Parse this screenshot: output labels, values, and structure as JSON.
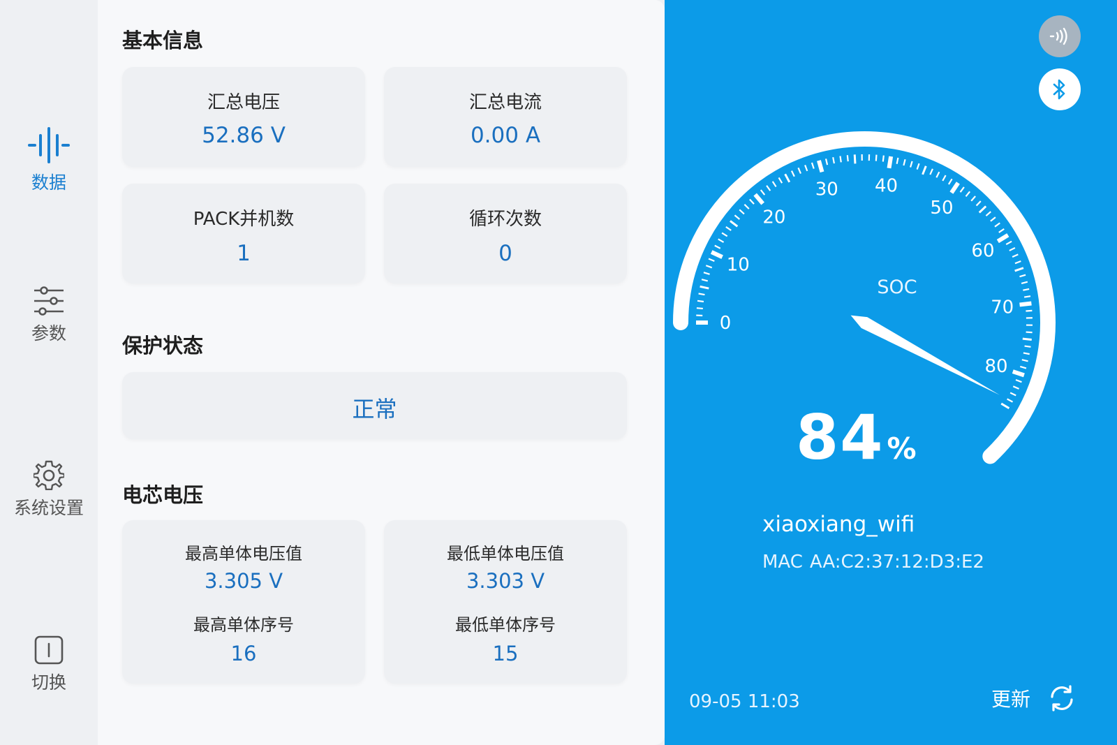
{
  "sidebar": {
    "items": [
      {
        "label": "数据",
        "icon": "data-bars-icon",
        "active": true
      },
      {
        "label": "参数",
        "icon": "sliders-icon",
        "active": false
      },
      {
        "label": "系统设置",
        "icon": "gear-icon",
        "active": false
      },
      {
        "label": "切换",
        "icon": "switch-icon",
        "active": false
      }
    ]
  },
  "basic_info": {
    "title": "基本信息",
    "cards": [
      {
        "label": "汇总电压",
        "value": "52.86 V"
      },
      {
        "label": "汇总电流",
        "value": "0.00 A"
      },
      {
        "label": "PACK并机数",
        "value": "1"
      },
      {
        "label": "循环次数",
        "value": "0"
      }
    ]
  },
  "protection": {
    "title": "保护状态",
    "status": "正常"
  },
  "cell_voltage": {
    "title": "电芯电压",
    "max": {
      "label": "最高单体电压值",
      "value": "3.305 V",
      "index_label": "最高单体序号",
      "index": "16"
    },
    "min": {
      "label": "最低单体电压值",
      "value": "3.303 V",
      "index_label": "最低单体序号",
      "index": "15"
    }
  },
  "panel": {
    "gauge": {
      "label": "SOC",
      "value": 84,
      "value_text": "84",
      "unit": "%",
      "min": 0,
      "max": 90,
      "tick_labels": [
        "0",
        "10",
        "20",
        "30",
        "40",
        "50",
        "60",
        "70",
        "80"
      ]
    },
    "wifi_name": "xiaoxiang_wifi",
    "mac_label": "MAC",
    "mac_value": "AA:C2:37:12:D3:E2",
    "timestamp": "09-05 11:03",
    "update_label": "更新",
    "icons": {
      "top_button": "nfc-signal-icon",
      "second_button": "bluetooth-icon",
      "refresh": "refresh-icon"
    }
  },
  "colors": {
    "accent": "#1a6fbf",
    "panel_bg": "#0c9be8",
    "card_bg": "#eef0f3"
  }
}
